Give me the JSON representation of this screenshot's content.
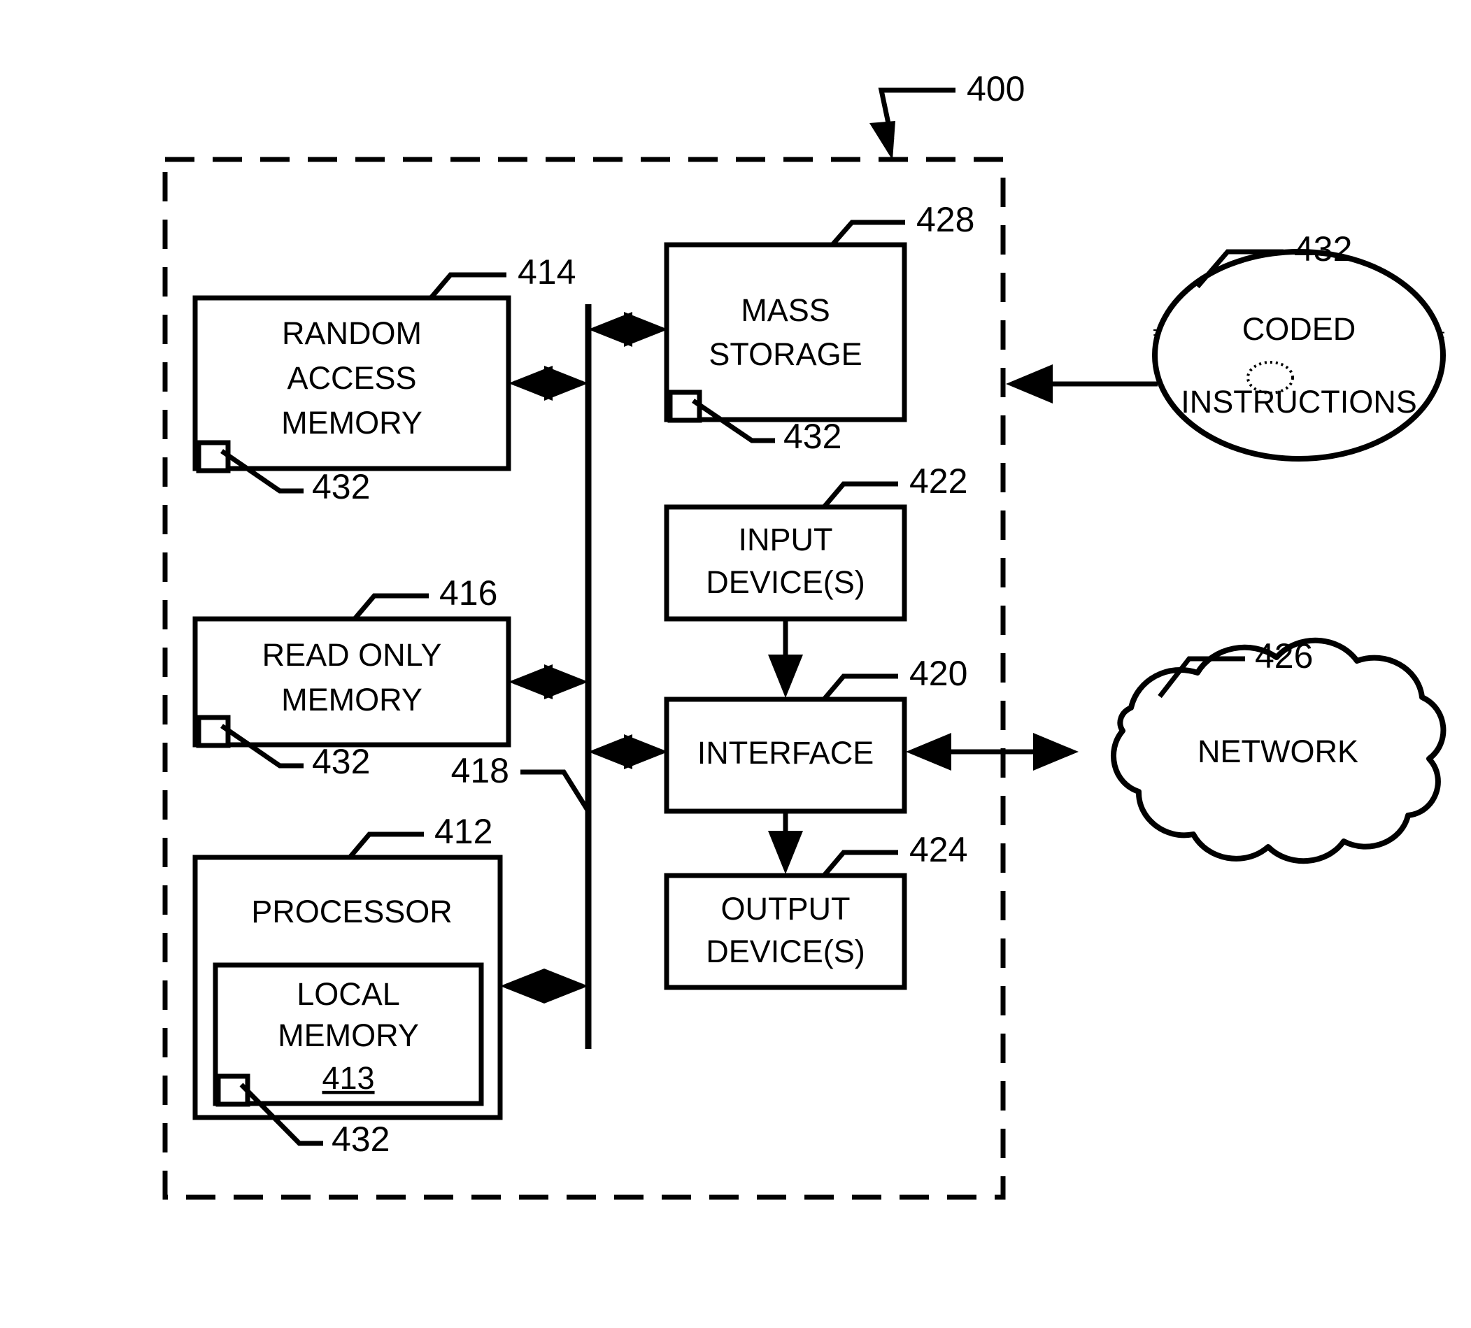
{
  "figure": {
    "id_label": "400",
    "title": "Processor Platform Block Diagram"
  },
  "boundary": {
    "name": "processor-platform-boundary",
    "style": "dashed"
  },
  "blocks": [
    {
      "key": "random_access_memory",
      "line1": "RANDOM",
      "line2": "ACCESS",
      "line3": "MEMORY",
      "ref": "414",
      "marker_ref": "432"
    },
    {
      "key": "read_only_memory",
      "line1": "READ ONLY",
      "line2": "MEMORY",
      "ref": "416",
      "marker_ref": "432"
    },
    {
      "key": "processor",
      "line1": "PROCESSOR",
      "ref": "412"
    },
    {
      "key": "local_memory",
      "line1": "LOCAL",
      "line2": "MEMORY",
      "ref": "413",
      "marker_ref": "432"
    },
    {
      "key": "mass_storage",
      "line1": "MASS",
      "line2": "STORAGE",
      "ref": "428",
      "marker_ref": "432"
    },
    {
      "key": "input_devices",
      "line1": "INPUT",
      "line2": "DEVICE(S)",
      "ref": "422"
    },
    {
      "key": "interface",
      "line1": "INTERFACE",
      "ref": "420"
    },
    {
      "key": "output_devices",
      "line1": "OUTPUT",
      "line2": "DEVICE(S)",
      "ref": "424"
    }
  ],
  "bus": {
    "key": "bus",
    "ref": "418"
  },
  "external": [
    {
      "key": "network",
      "label": "NETWORK",
      "ref": "426",
      "shape": "cloud"
    },
    {
      "key": "coded_instructions",
      "line1": "CODED",
      "line2": "INSTRUCTIONS",
      "ref": "432",
      "shape": "disc"
    }
  ],
  "colors": {
    "ink": "#000000",
    "paper": "#ffffff"
  }
}
